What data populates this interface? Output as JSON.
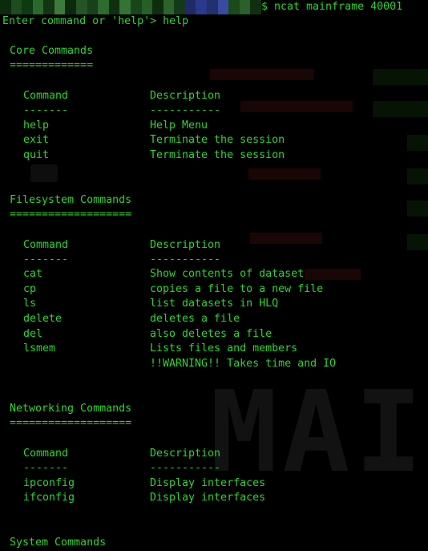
{
  "terminal": {
    "top_command": "$ ncat mainframe 40001",
    "prompt_line": "Enter command or 'help'> help",
    "background_watermark": "MAI"
  },
  "headers": {
    "command": "Command",
    "description": "Description",
    "command_underline": "-------",
    "description_underline": "-----------"
  },
  "sections": [
    {
      "title": "Core Commands",
      "underline": "=============",
      "rows": [
        {
          "command": "help",
          "description": "Help Menu"
        },
        {
          "command": "exit",
          "description": "Terminate the session"
        },
        {
          "command": "quit",
          "description": "Terminate the session"
        }
      ]
    },
    {
      "title": "Filesystem Commands",
      "underline": "===================",
      "rows": [
        {
          "command": "cat",
          "description": "Show contents of dataset"
        },
        {
          "command": "cp",
          "description": "copies a file to a new file"
        },
        {
          "command": "ls",
          "description": "list datasets in HLQ"
        },
        {
          "command": "delete",
          "description": "deletes a file"
        },
        {
          "command": "del",
          "description": "also deletes a file"
        },
        {
          "command": "lsmem",
          "description": "Lists files and members"
        },
        {
          "command": "",
          "description": "!!WARNING!! Takes time and IO"
        }
      ]
    },
    {
      "title": "Networking Commands",
      "underline": "===================",
      "rows": [
        {
          "command": "ipconfig",
          "description": "Display interfaces"
        },
        {
          "command": "ifconfig",
          "description": "Display interfaces"
        }
      ]
    },
    {
      "title": "System Commands",
      "underline": "",
      "rows": []
    }
  ],
  "colors": {
    "text": "#2bd62b",
    "background": "#000000"
  }
}
